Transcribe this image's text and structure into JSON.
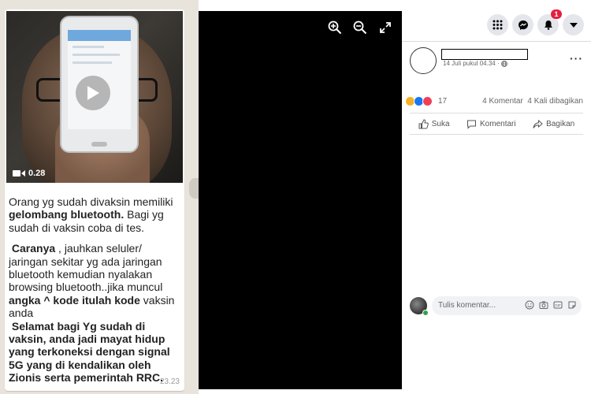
{
  "chat": {
    "video": {
      "duration": "0.28",
      "icons": [
        "video-camera-icon",
        "play-icon"
      ]
    },
    "message": {
      "p1_a": "Orang yg sudah divaksin memiliki ",
      "p1_b": "gelombang bluetooth.",
      "p1_c": " Bagi yg sudah di vaksin coba di tes.",
      "p2_a": "Caranya",
      "p2_b": " , jauhkan seluler/ jaringan sekitar yg ada jaringan bluetooth kemudian nyalakan browsing bluetooth..jika muncul ",
      "p2_c": "angka ^ kode itulah kode",
      "p2_d": " vaksin anda",
      "p3": "Selamat bagi Yg sudah di vaksin, anda jadi mayat hidup yang terkoneksi dengan signal 5G yang di kendalikan oleh Zionis serta pemerintah RRC."
    },
    "time": "23.23"
  },
  "viewer": {
    "tools": [
      "zoom-in-icon",
      "zoom-out-icon",
      "fullscreen-icon"
    ]
  },
  "facebook": {
    "topbar": {
      "notification_count": "1",
      "icons": [
        "menu-grid-icon",
        "messenger-icon",
        "bell-icon",
        "caret-down-icon"
      ]
    },
    "post": {
      "timestamp": "14 Juli pukul 04.34 ·",
      "reaction_count": "17",
      "comments": "4 Komentar",
      "shares": "4 Kali dibagikan"
    },
    "actions": {
      "like": "Suka",
      "comment": "Komentari",
      "share": "Bagikan"
    },
    "comment_box": {
      "placeholder": "Tulis komentar..."
    }
  },
  "colors": {
    "viewer_bg": "#000000",
    "chat_bg": "#e8e4dc",
    "badge": "#e41e3f",
    "online": "#31a24c"
  }
}
